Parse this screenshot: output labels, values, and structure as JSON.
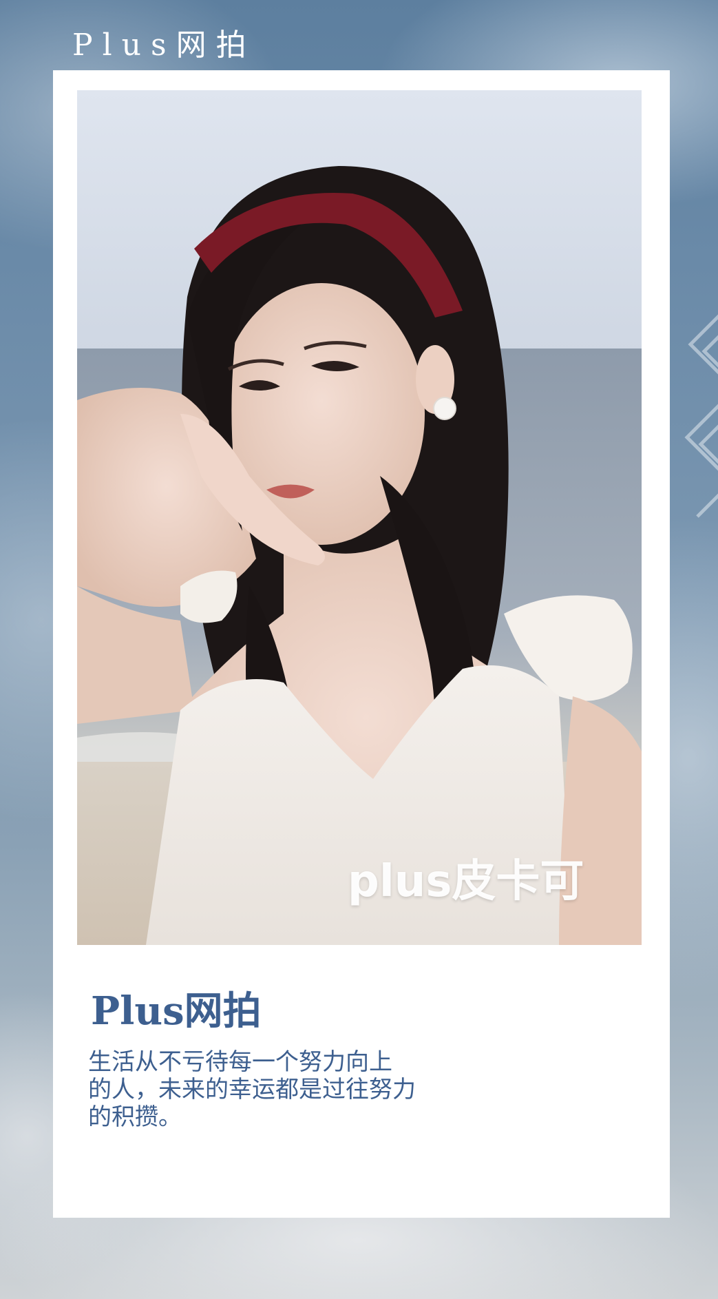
{
  "header": {
    "brand": "Plus网拍"
  },
  "photo": {
    "watermark": "plus皮卡可"
  },
  "card": {
    "title": "Plus网拍",
    "body_lines": [
      "生活从不亏待每一个努力向上",
      "的人，未来的幸运都是过往努力",
      "的积攒。"
    ]
  },
  "colors": {
    "accent": "#3d5f8f",
    "card_background": "#ffffff",
    "background_blue": "#6a8aa8"
  }
}
